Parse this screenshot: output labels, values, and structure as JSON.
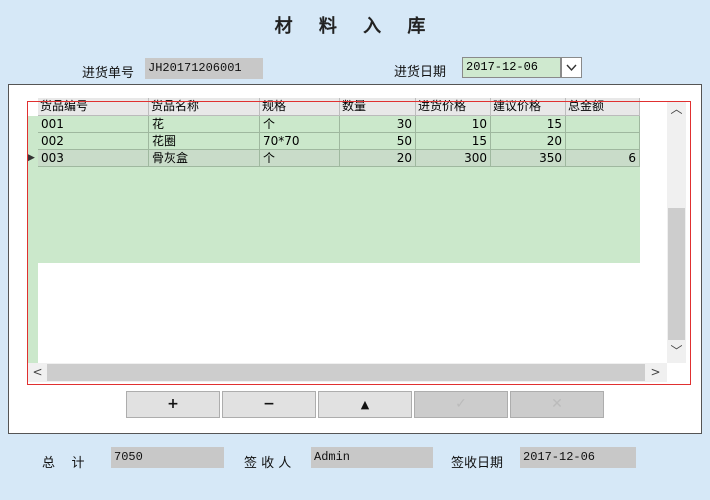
{
  "title": "材 料 入 库",
  "receipt": {
    "number_label": "进货单号",
    "number_value": "JH20171206001",
    "date_label": "进货日期",
    "date_value": "2017-12-06",
    "date_dropdown_icon": "chevron-down-icon"
  },
  "table": {
    "columns": [
      "货品编号",
      "货品名称",
      "规格",
      "数量",
      "进货价格",
      "建议价格",
      "总金额"
    ],
    "rows": [
      {
        "code": "001",
        "name": "花",
        "spec": "个",
        "qty": "30",
        "price": "10",
        "suggested": "15",
        "total": ""
      },
      {
        "code": "002",
        "name": "花圈",
        "spec": "70*70",
        "qty": "50",
        "price": "15",
        "suggested": "20",
        "total": ""
      },
      {
        "code": "003",
        "name": "骨灰盒",
        "spec": "个",
        "qty": "20",
        "price": "300",
        "suggested": "350",
        "total": "6"
      }
    ],
    "current_row_marker": "▶"
  },
  "toolbar": {
    "add": "+",
    "remove": "−",
    "up": "▲",
    "confirm": "✓",
    "cancel": "✕"
  },
  "footer": {
    "total_label": "总    计",
    "total_value": "7050",
    "receiver_label": "签 收 人",
    "receiver_value": "Admin",
    "receive_date_label": "签收日期",
    "receive_date_value": "2017-12-06"
  },
  "scroll": {
    "up_arrow": "︿",
    "down_arrow": "﹀",
    "left_arrow": "<",
    "right_arrow": ">"
  }
}
